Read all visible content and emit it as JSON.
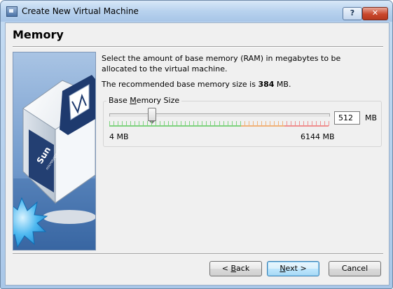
{
  "window": {
    "title": "Create New Virtual Machine",
    "help_label": "?",
    "close_label": "✕"
  },
  "page": {
    "title": "Memory",
    "description": "Select the amount of base memory (RAM) in megabytes to be allocated to the virtual machine.",
    "recommended_prefix": "The recommended base memory size is ",
    "recommended_value": "384",
    "recommended_suffix": " MB."
  },
  "memory": {
    "group_label_pre": "Base ",
    "group_label_accel": "M",
    "group_label_post": "emory Size",
    "value": "512",
    "unit": "MB",
    "min_label": "4 MB",
    "max_label": "6144 MB",
    "min_mb": 4,
    "max_mb": 6144,
    "current_mb": 512,
    "tick_colors": {
      "green": "#7fd27f",
      "orange": "#f0b27a",
      "red": "#ee8f8f"
    }
  },
  "side_image": {
    "brand_text": "Sun",
    "sub_text": "microsystems"
  },
  "buttons": {
    "back_pre": "< ",
    "back_accel": "B",
    "back_post": "ack",
    "next_pre": "",
    "next_accel": "N",
    "next_post": "ext >",
    "cancel": "Cancel"
  }
}
